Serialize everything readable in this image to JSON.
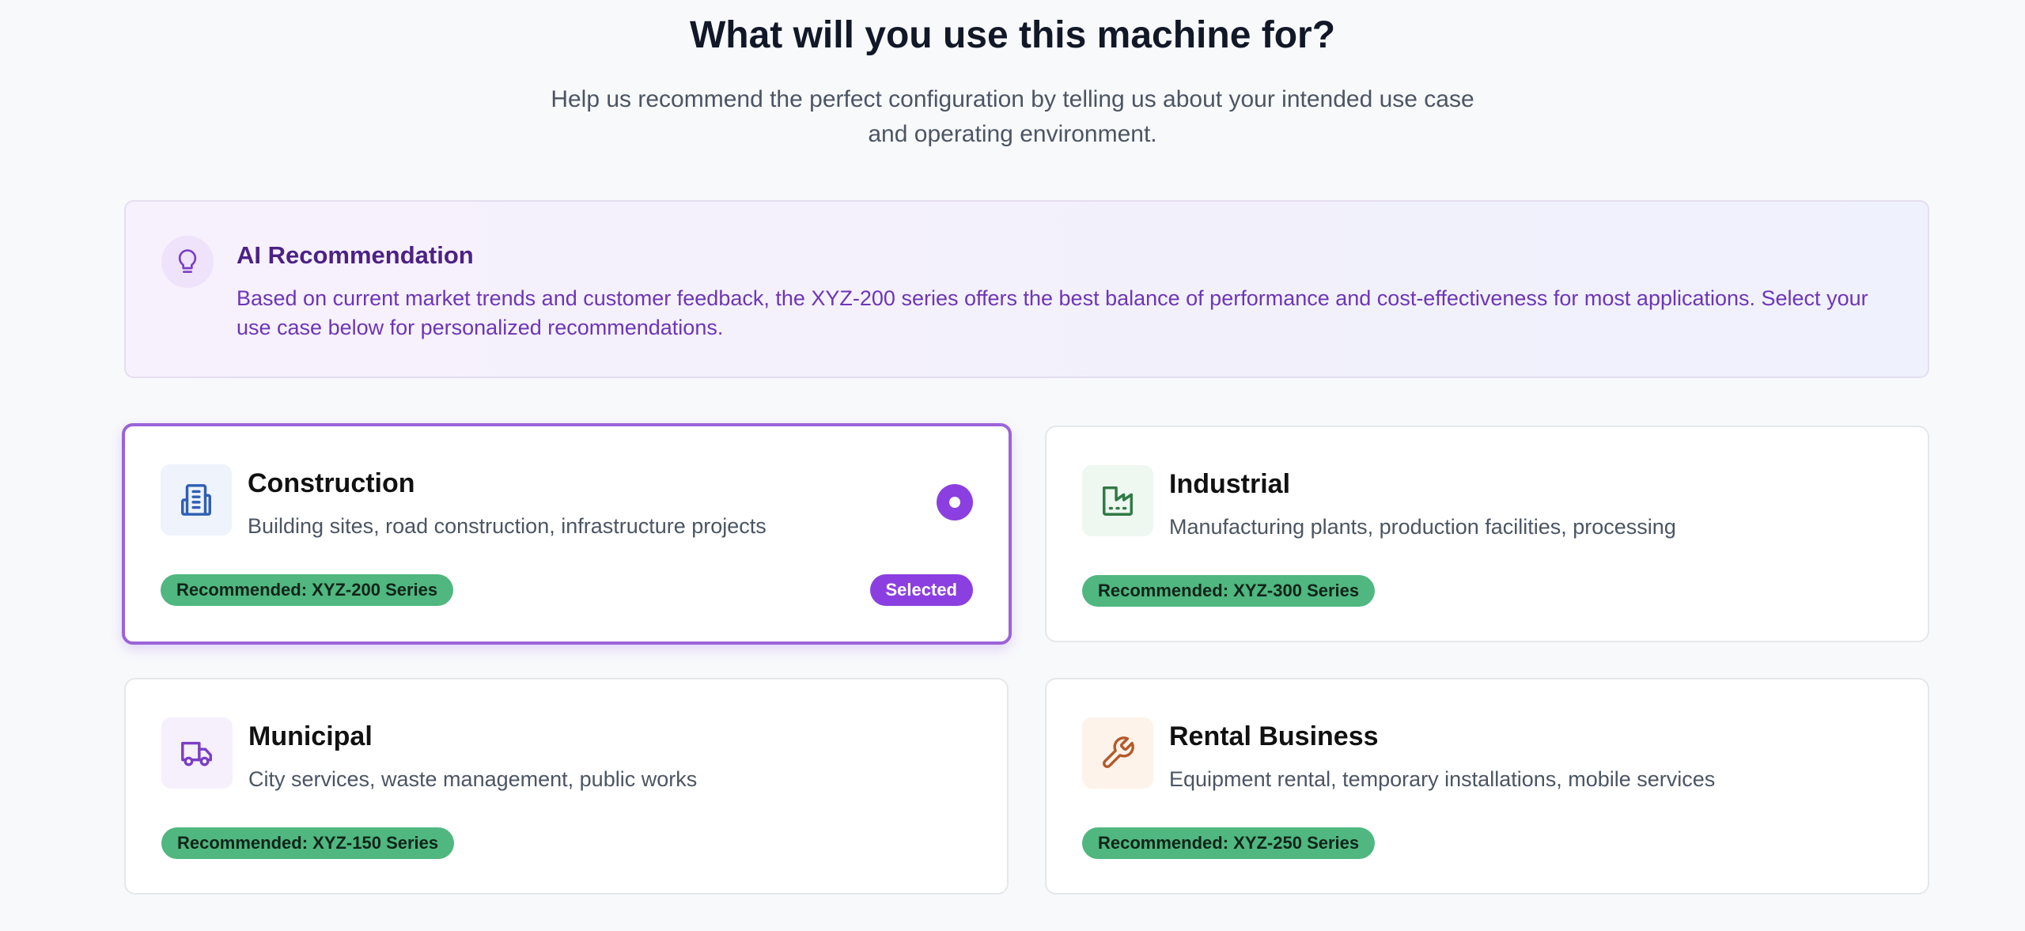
{
  "header": {
    "title": "What will you use this machine for?",
    "subtitle_line1": "Help us recommend the perfect configuration by telling us about your intended use case",
    "subtitle_line2": "and operating environment."
  },
  "ai_recommendation": {
    "icon": "lightbulb-icon",
    "title": "AI Recommendation",
    "text": "Based on current market trends and customer feedback, the XYZ-200 series offers the best balance of performance and cost-effectiveness for most applications. Select your use case below for personalized recommendations."
  },
  "use_cases": [
    {
      "id": "construction",
      "icon": "building-icon",
      "title": "Construction",
      "description": "Building sites, road construction, infrastructure projects",
      "recommendation": "Recommended: XYZ-200 Series",
      "selected": true,
      "selected_label": "Selected"
    },
    {
      "id": "industrial",
      "icon": "factory-icon",
      "title": "Industrial",
      "description": "Manufacturing plants, production facilities, processing",
      "recommendation": "Recommended: XYZ-300 Series",
      "selected": false
    },
    {
      "id": "municipal",
      "icon": "truck-icon",
      "title": "Municipal",
      "description": "City services, waste management, public works",
      "recommendation": "Recommended: XYZ-150 Series",
      "selected": false
    },
    {
      "id": "rental",
      "icon": "wrench-icon",
      "title": "Rental Business",
      "description": "Equipment rental, temporary installations, mobile services",
      "recommendation": "Recommended: XYZ-250 Series",
      "selected": false
    }
  ],
  "colors": {
    "accent": "#8b3fe0",
    "recommendation_badge": "#4fb77f",
    "ai_title": "#4c2184",
    "ai_text": "#6d35b8"
  }
}
